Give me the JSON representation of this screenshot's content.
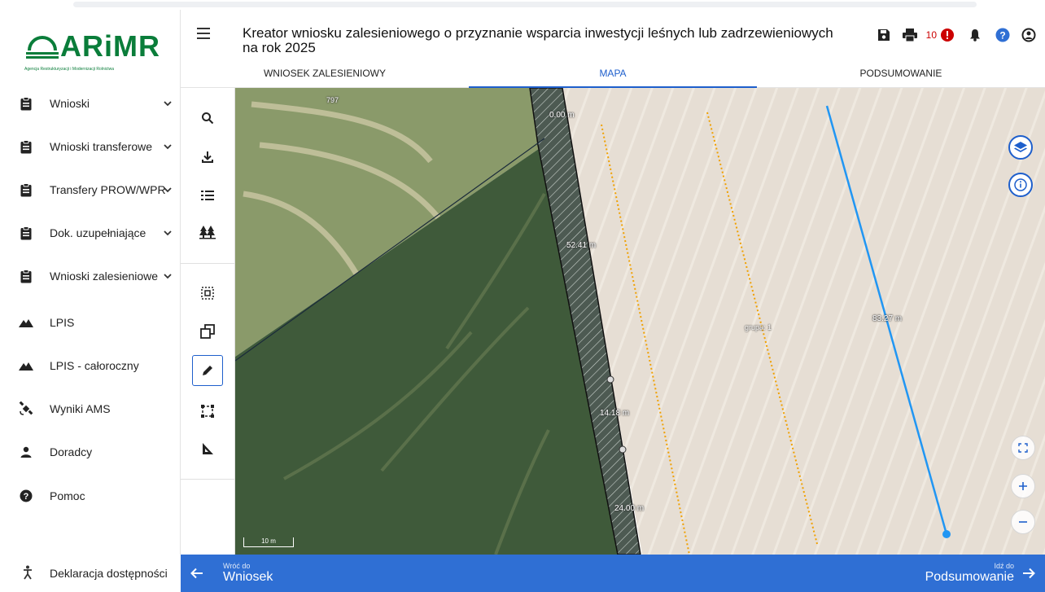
{
  "logo": {
    "brand": "ARiMR",
    "tagline": "Agencja Restrukturyzacji i Modernizacji Rolnictwa"
  },
  "sidebar": {
    "items": [
      {
        "label": "Wnioski",
        "icon": "clipboard-icon",
        "expandable": true
      },
      {
        "label": "Wnioski transferowe",
        "icon": "clipboard-icon",
        "expandable": true
      },
      {
        "label": "Transfery PROW/WPR",
        "icon": "clipboard-icon",
        "expandable": true
      },
      {
        "label": "Dok. uzupełniające",
        "icon": "clipboard-icon",
        "expandable": true
      },
      {
        "label": "Wnioski zalesieniowe",
        "icon": "clipboard-icon",
        "expandable": true
      },
      {
        "label": "LPIS",
        "icon": "mountain-icon",
        "expandable": false
      },
      {
        "label": "LPIS - całoroczny",
        "icon": "mountain-icon",
        "expandable": false
      },
      {
        "label": "Wyniki AMS",
        "icon": "satellite-icon",
        "expandable": false
      },
      {
        "label": "Doradcy",
        "icon": "person-icon",
        "expandable": false
      },
      {
        "label": "Pomoc",
        "icon": "help-icon",
        "expandable": false
      }
    ],
    "accessibility": {
      "label": "Deklaracja dostępności",
      "icon": "accessibility-icon"
    }
  },
  "header": {
    "title": "Kreator wniosku zalesieniowego o przyznanie wsparcia inwestycji leśnych lub zadrzewieniowych na rok 2025",
    "error_count": "10",
    "icons": [
      "save-icon",
      "print-icon",
      "error-icon",
      "bell-icon",
      "help-icon",
      "user-icon"
    ],
    "tabs": [
      {
        "label": "WNIOSEK ZALESIENIOWY",
        "active": false
      },
      {
        "label": "MAPA",
        "active": true
      },
      {
        "label": "PODSUMOWANIE",
        "active": false
      }
    ]
  },
  "tools": [
    "search-icon",
    "download-icon",
    "list-icon",
    "forest-icon",
    "select-area-icon",
    "copy-icon",
    "pencil-icon",
    "rectangle-select-icon",
    "measure-angle-icon"
  ],
  "map": {
    "parcel_number": "797",
    "scale": "10 m",
    "labels": {
      "dist_top": "0.00 m",
      "dist_1": "52.41 m",
      "dist_2": "14.18 m",
      "dist_3": "24.00 m",
      "line_length": "83.27 m",
      "group": "grupa: 1"
    },
    "colors": {
      "accent": "#1e5fcc",
      "bottom_bar": "#2f6fd4",
      "measure_line": "#2196f3",
      "dotted_line": "#f0a000"
    }
  },
  "footer": {
    "back_small": "Wróć do",
    "back_big": "Wniosek",
    "next_small": "Idź do",
    "next_big": "Podsumowanie"
  }
}
